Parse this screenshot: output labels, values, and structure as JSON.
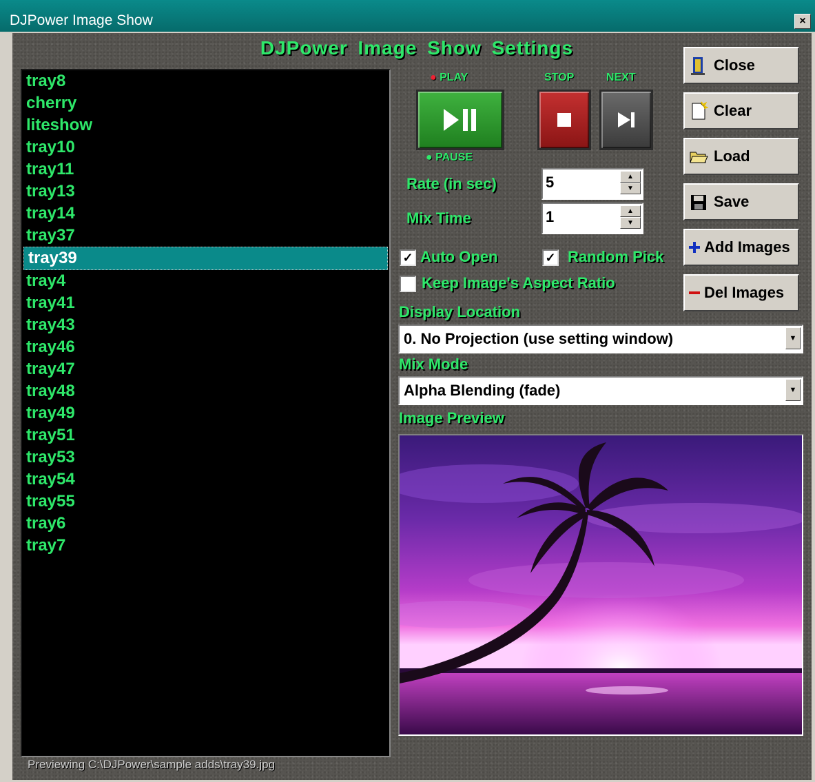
{
  "window": {
    "title": "DJPower Image Show",
    "close_glyph": "×"
  },
  "heading": "DJPower Image Show Settings",
  "playlist": {
    "items": [
      "tray8",
      "cherry",
      "liteshow",
      "tray10",
      "tray11",
      "tray13",
      "tray14",
      "tray37",
      "tray39",
      "tray4",
      "tray41",
      "tray43",
      "tray46",
      "tray47",
      "tray48",
      "tray49",
      "tray51",
      "tray53",
      "tray54",
      "tray55",
      "tray6",
      "tray7"
    ],
    "selected": "tray39"
  },
  "transport": {
    "play_label": "PLAY",
    "pause_label": "PAUSE",
    "stop_label": "STOP",
    "next_label": "NEXT",
    "play_icon": "play-pause-icon",
    "stop_icon": "stop-icon",
    "next_icon": "skip-next-icon"
  },
  "rate": {
    "label": "Rate (in sec)",
    "value": "5"
  },
  "mix_time": {
    "label": "Mix Time",
    "value": "1"
  },
  "options": {
    "auto_open": {
      "label": "Auto Open",
      "checked": true
    },
    "random_pick": {
      "label": "Random Pick",
      "checked": true
    },
    "keep_aspect": {
      "label": "Keep Image's Aspect Ratio",
      "checked": false
    }
  },
  "display_location": {
    "label": "Display Location",
    "value": "0. No Projection (use setting window)"
  },
  "mix_mode": {
    "label": "Mix Mode",
    "value": "Alpha Blending (fade)"
  },
  "preview": {
    "label": "Image Preview"
  },
  "buttons": {
    "close": "Close",
    "clear": "Clear",
    "load": "Load",
    "save": "Save",
    "add_images": "Add Images",
    "del_images": "Del Images"
  },
  "status_text": "Previewing C:\\DJPower\\sample adds\\tray39.jpg",
  "colors": {
    "accent_green": "#2ee86a",
    "title_teal": "#0a8a8a",
    "selection": "#0a8a8a"
  }
}
